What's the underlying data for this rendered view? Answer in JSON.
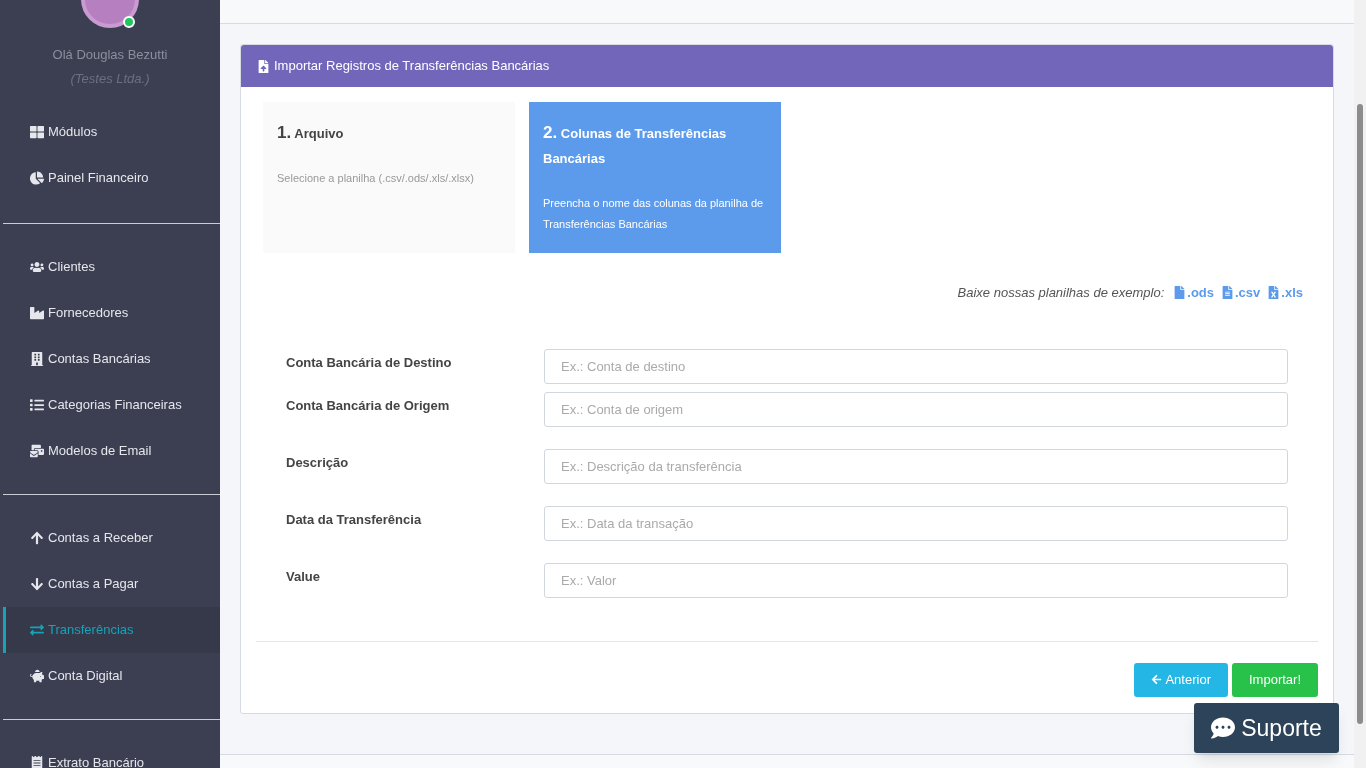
{
  "user": {
    "greeting": "Olá Douglas Bezutti",
    "company": "(Testes Ltda.)",
    "online": true
  },
  "sidebar": {
    "groups": [
      {
        "items": [
          {
            "label": "Módulos",
            "selected": false
          },
          {
            "label": "Painel Financeiro",
            "selected": false
          }
        ]
      },
      {
        "items": [
          {
            "label": "Clientes",
            "selected": false
          },
          {
            "label": "Fornecedores",
            "selected": false
          },
          {
            "label": "Contas Bancárias",
            "selected": false
          },
          {
            "label": "Categorias Financeiras",
            "selected": false
          },
          {
            "label": "Modelos de Email",
            "selected": false
          }
        ]
      },
      {
        "items": [
          {
            "label": "Contas a Receber",
            "selected": false
          },
          {
            "label": "Contas a Pagar",
            "selected": false
          },
          {
            "label": "Transferências",
            "selected": true
          },
          {
            "label": "Conta Digital",
            "selected": false
          }
        ]
      },
      {
        "items": [
          {
            "label": "Extrato Bancário",
            "selected": false
          }
        ]
      }
    ]
  },
  "card": {
    "title": "Importar Registros de Transferências Bancárias",
    "steps": [
      {
        "number": "1.",
        "title": "Arquivo",
        "description": "Selecione a planilha (.csv/.ods/.xls/.xlsx)",
        "selected": false
      },
      {
        "number": "2.",
        "title": "Colunas de Transferências Bancárias",
        "description": "Preencha o nome das colunas da planilha de Transferências Bancárias",
        "selected": true
      }
    ],
    "downloads": {
      "label": "Baixe nossas planilhas de exemplo:",
      "links": [
        ".ods",
        ".csv",
        ".xls"
      ]
    },
    "fields": [
      {
        "label": "Conta Bancária de Destino",
        "placeholder": "Ex.: Conta de destino"
      },
      {
        "label": "Conta Bancária de Origem",
        "placeholder": "Ex.: Conta de origem"
      },
      {
        "label": "Descrição",
        "placeholder": "Ex.: Descrição da transferência"
      },
      {
        "label": "Data da Transferência",
        "placeholder": "Ex.: Data da transação"
      },
      {
        "label": "Value",
        "placeholder": "Ex.: Valor"
      }
    ],
    "buttons": [
      {
        "kind": "back",
        "label": "Anterior"
      },
      {
        "kind": "submit",
        "label": "Importar!"
      }
    ]
  },
  "support_button": "Suporte"
}
